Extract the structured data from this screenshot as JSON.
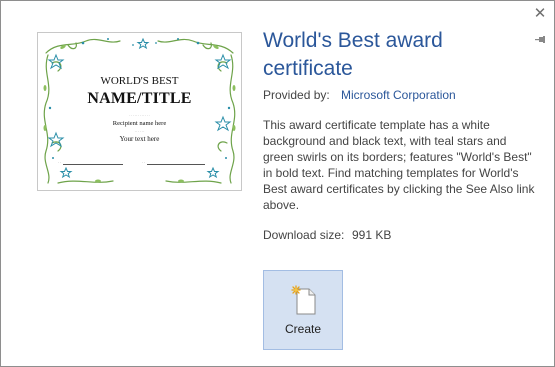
{
  "dialog": {
    "title": "World's Best award certificate",
    "provided_by_label": "Provided by:",
    "provided_by_value": "Microsoft Corporation",
    "description": "This award certificate template has a white background and black text, with teal stars and green swirls on its borders; features \"World's Best\" in bold text. Find matching templates for World's Best award certificates by clicking the See Also link above.",
    "download_size_label": "Download size:",
    "download_size_value": "991 KB",
    "create_label": "Create",
    "close_icon": "close-icon",
    "pin_icon": "pin-icon"
  },
  "preview": {
    "heading": "WORLD'S BEST",
    "name": "NAME/TITLE",
    "recipient": "Recipient name here",
    "body_text": "Your text here"
  },
  "colors": {
    "accent": "#2b579a",
    "button_bg": "#d5e1f2",
    "button_border": "#a3bde3",
    "swirl_green": "#6ea34a",
    "star_teal": "#2a8ea8"
  }
}
